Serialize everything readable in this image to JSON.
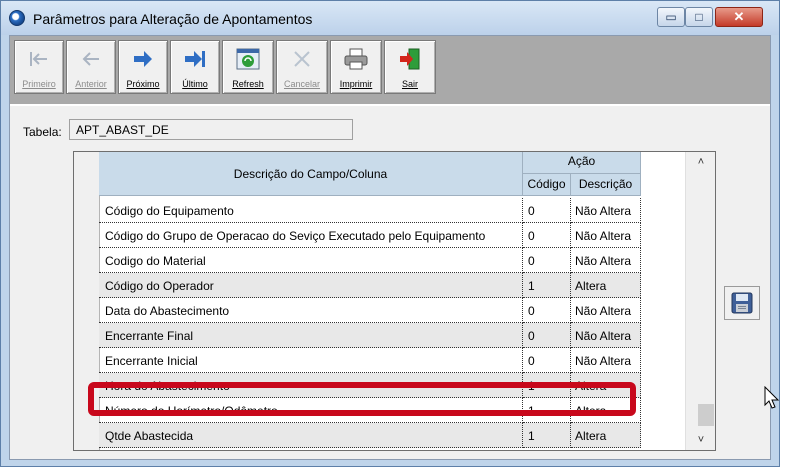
{
  "window": {
    "title": "Parâmetros para Alteração de Apontamentos",
    "controls": {
      "minimize": "▭",
      "maximize": "□",
      "close": "✕"
    }
  },
  "toolbar": {
    "buttons": [
      {
        "label": "Primeiro",
        "icon": "first-record-icon",
        "enabled": false
      },
      {
        "label": "Anterior",
        "icon": "previous-record-icon",
        "enabled": false
      },
      {
        "label": "Próximo",
        "icon": "next-record-icon",
        "enabled": true
      },
      {
        "label": "Último",
        "icon": "last-record-icon",
        "enabled": true
      },
      {
        "label": "Refresh",
        "icon": "refresh-icon",
        "enabled": true
      },
      {
        "label": "Cancelar",
        "icon": "cancel-icon",
        "enabled": false
      },
      {
        "label": "Imprimir",
        "icon": "printer-icon",
        "enabled": true
      },
      {
        "label": "Sair",
        "icon": "exit-door-icon",
        "enabled": true
      }
    ]
  },
  "tabela": {
    "label": "Tabela:",
    "value": "APT_ABAST_DE"
  },
  "grid": {
    "headers": {
      "descricao_campo": "Descrição do Campo/Coluna",
      "acao": "Ação",
      "codigo": "Código",
      "descricao": "Descrição"
    },
    "rows": [
      {
        "campo": "Código do Equipamento",
        "codigo": "0",
        "descricao": "Não Altera"
      },
      {
        "campo": "Código do Grupo de Operacao do Seviço Executado pelo Equipamento",
        "codigo": "0",
        "descricao": "Não Altera"
      },
      {
        "campo": "Codigo do Material",
        "codigo": "0",
        "descricao": "Não Altera"
      },
      {
        "campo": "Código do Operador",
        "codigo": "1",
        "descricao": "Altera"
      },
      {
        "campo": "Data do Abastecimento",
        "codigo": "0",
        "descricao": "Não Altera"
      },
      {
        "campo": "Encerrante Final",
        "codigo": "0",
        "descricao": "Não Altera"
      },
      {
        "campo": "Encerrante Inicial",
        "codigo": "0",
        "descricao": "Não Altera"
      },
      {
        "campo": "Hora do Abastecimento",
        "codigo": "1",
        "descricao": "Altera"
      },
      {
        "campo": "Número do Horímetro/Odômetro",
        "codigo": "1",
        "descricao": "Altera"
      },
      {
        "campo": "Qtde Abastecida",
        "codigo": "1",
        "descricao": "Altera"
      }
    ],
    "scroll_up": "˄",
    "scroll_down": "˅"
  },
  "colors": {
    "highlight": "#c8081c",
    "header_bg": "#c9dbea",
    "window_frame": "#bfd4ea"
  },
  "side": {
    "save_icon": "floppy-save-icon"
  }
}
